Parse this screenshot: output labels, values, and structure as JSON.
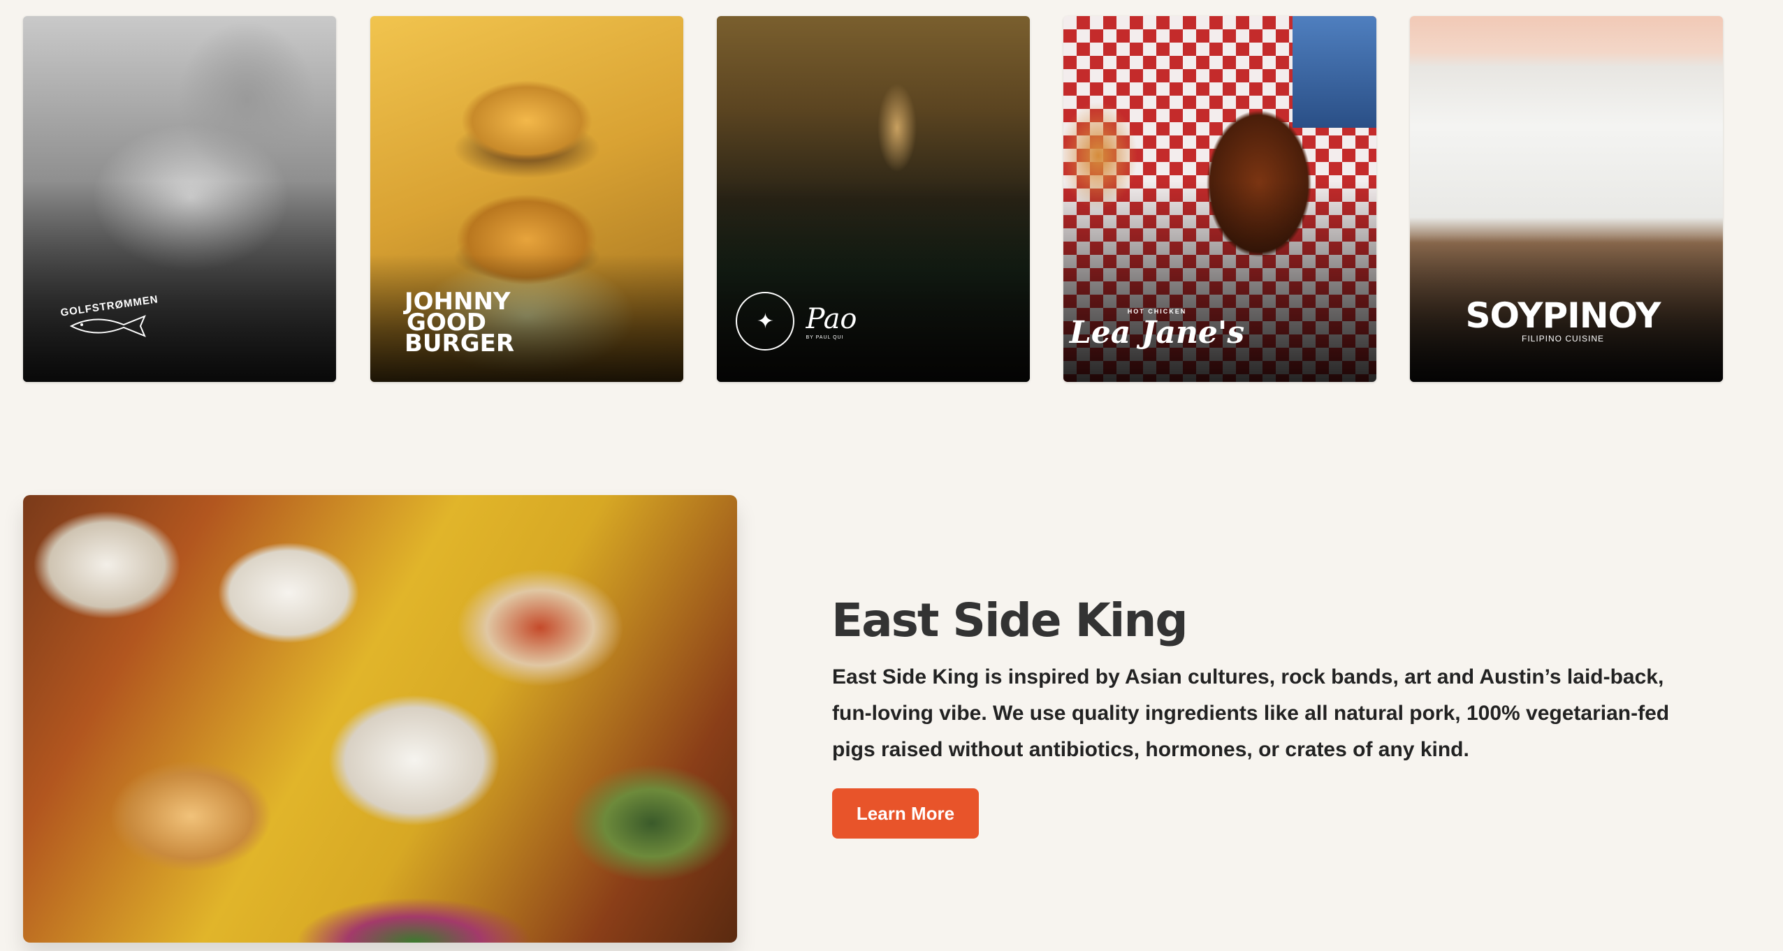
{
  "restaurants": [
    {
      "name": "GOLFSTRØMMEN"
    },
    {
      "name": "JOHNNY GOOD BURGER"
    },
    {
      "name": "Pao",
      "subtitle": "BY PAUL QUI"
    },
    {
      "name": "Lea Jane's",
      "tagline": "HOT CHICKEN"
    },
    {
      "name": "SOYPINOY",
      "subtitle": "FILIPINO CUISINE"
    }
  ],
  "feature": {
    "title": "East Side King",
    "description": "East Side King is inspired by Asian cultures, rock bands, art and Austin’s laid-back, fun-loving vibe. We use quality ingredients like all natural pork, 100% vegetarian-fed pigs raised without antibiotics, hormones, or crates of any kind.",
    "button_label": "Learn More"
  },
  "colors": {
    "background": "#f7f4ef",
    "button": "#e8542a",
    "title": "#333333"
  }
}
